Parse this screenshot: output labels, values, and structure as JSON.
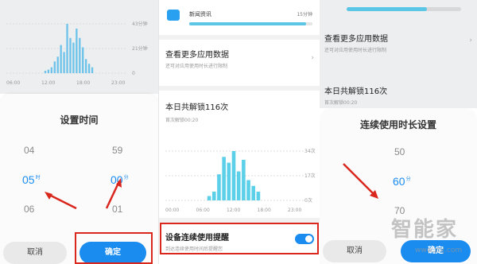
{
  "panel_left": {
    "chart_axis": {
      "y_labels": [
        "43分钟",
        "21分钟",
        "0"
      ],
      "x_labels": [
        "06:00",
        "12:00",
        "18:00",
        "23:00"
      ],
      "bars": [
        2,
        3,
        5,
        10,
        14,
        24,
        18,
        42,
        30,
        26,
        38,
        30,
        22,
        12,
        8,
        5
      ],
      "bar_color": "#6ec3ea"
    },
    "sheet_title": "设置时间",
    "hour_wheel": [
      "04",
      "05",
      "06"
    ],
    "hour_unit": "时",
    "minute_wheel": [
      "59",
      "00",
      "01"
    ],
    "minute_unit": "分",
    "cancel_label": "取消",
    "ok_label": "确定"
  },
  "panel_middle": {
    "app_name": "新闻资讯",
    "app_time": "15分钟",
    "app_usage_fraction": 0.95,
    "more_data_title": "查看更多应用数据",
    "more_data_sub": "还可对应用使用时长进行限制",
    "unlock_title": "本日共解锁116次",
    "first_unlock": "首次解锁00:20",
    "chart_axis": {
      "y_labels": [
        "34次",
        "17次",
        "0次"
      ],
      "x_labels": [
        "00:00",
        "06:00",
        "12:00",
        "18:00",
        "23:00"
      ],
      "bars": [
        3,
        6,
        18,
        30,
        26,
        34,
        20,
        28,
        14,
        10,
        6
      ],
      "bar_color": "#5bd0e8"
    },
    "reminder_title": "设备连续使用提醒",
    "reminder_sub": "到达连续使用时间后提醒您",
    "reminder_enabled": true
  },
  "panel_right": {
    "more_data_title": "查看更多应用数据",
    "more_data_sub": "还可对应用使用时长进行限制",
    "unlock_title": "本日共解锁116次",
    "first_unlock": "首次解锁00:20",
    "sheet_title": "连续使用时长设置",
    "wheel": [
      "50",
      "60",
      "70"
    ],
    "unit": "分",
    "cancel_label": "取消",
    "ok_label": "确定",
    "watermark_name": "智能家",
    "watermark_url": "www.znj.com"
  }
}
